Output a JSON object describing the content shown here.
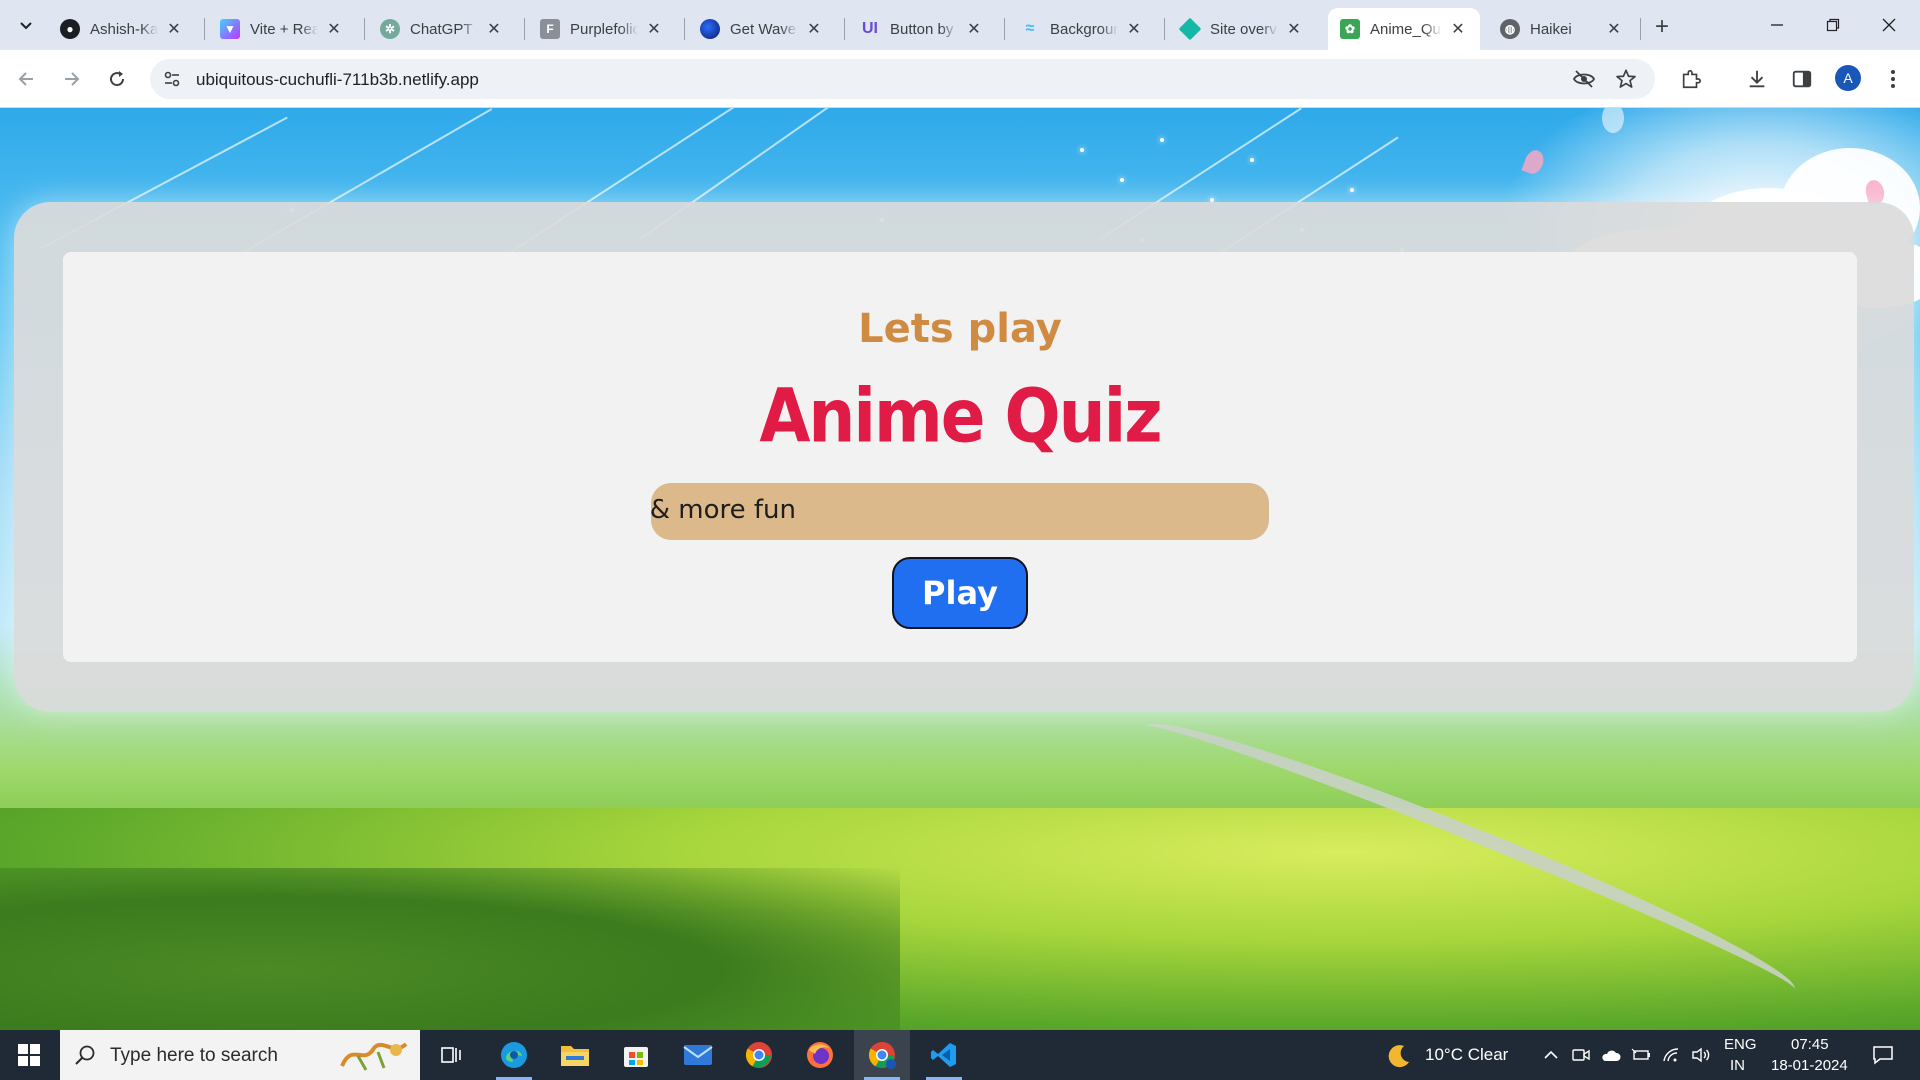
{
  "browser": {
    "tabs": [
      {
        "title": "Ashish-Kai",
        "icon": "github-icon"
      },
      {
        "title": "Vite + Rea",
        "icon": "vite-icon"
      },
      {
        "title": "ChatGPT",
        "icon": "chatgpt-icon"
      },
      {
        "title": "Purplefolic",
        "icon": "purplefolio-icon"
      },
      {
        "title": "Get Waves",
        "icon": "waves-icon"
      },
      {
        "title": "Button by",
        "icon": "uiverse-icon"
      },
      {
        "title": "Backgroun",
        "icon": "tailwind-icon"
      },
      {
        "title": "Site overvi",
        "icon": "netlify-icon"
      },
      {
        "title": "Anime_Qu",
        "icon": "anime-quiz-icon",
        "active": true
      },
      {
        "title": "Haikei",
        "icon": "globe-icon"
      }
    ],
    "url": "ubiquitous-cuchufli-711b3b.netlify.app",
    "avatar_letter": "A"
  },
  "page": {
    "subtitle": "Lets play",
    "title": "Anime Quiz",
    "marquee_text": "n & more fun",
    "play_label": "Play",
    "colors": {
      "subtitle": "#d08b42",
      "title": "#e01b45",
      "marquee_bg": "#dbb98b",
      "play_bg": "#1f6ff0"
    }
  },
  "taskbar": {
    "search_placeholder": "Type here to search",
    "apps": [
      "task-view-icon",
      "edge-icon",
      "file-explorer-icon",
      "store-icon",
      "mail-icon",
      "chrome-icon",
      "firefox-icon",
      "chrome-profile-icon",
      "vscode-icon"
    ],
    "weather": "10°C  Clear",
    "language_top": "ENG",
    "language_bottom": "IN",
    "time": "07:45",
    "date": "18-01-2024"
  }
}
